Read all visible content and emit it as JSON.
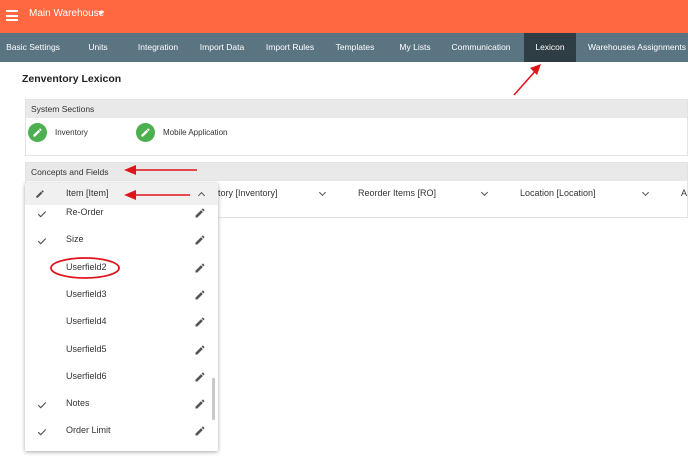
{
  "header": {
    "warehouse_name": "Main Warehouse",
    "menu_icon": "hamburger-icon",
    "caret_icon": "caret-down-icon",
    "accent_color": "#ff6840"
  },
  "nav": {
    "bar_color": "#5b7482",
    "active_color": "#2f3d45",
    "tabs": [
      {
        "label": "Basic Settings"
      },
      {
        "label": "Units"
      },
      {
        "label": "Integration"
      },
      {
        "label": "Import Data"
      },
      {
        "label": "Import Rules"
      },
      {
        "label": "Templates"
      },
      {
        "label": "My Lists"
      },
      {
        "label": "Communication"
      },
      {
        "label": "Lexicon"
      },
      {
        "label": "Warehouses Assignments"
      }
    ],
    "active_tab": "Lexicon"
  },
  "page": {
    "title": "Zenventory Lexicon"
  },
  "system_sections": {
    "heading": "System Sections",
    "items": [
      {
        "label": "Inventory",
        "icon": "pencil-icon"
      },
      {
        "label": "Mobile Application",
        "icon": "pencil-icon"
      }
    ]
  },
  "concepts": {
    "heading": "Concepts and Fields",
    "selects": [
      {
        "label": "Item [Item]"
      },
      {
        "label": "tory [Inventory]"
      },
      {
        "label": "Reorder Items [RO]"
      },
      {
        "label": "Location [Location]"
      },
      {
        "label": "A"
      }
    ]
  },
  "dropdown": {
    "header_label": "Item [Item]",
    "items": [
      {
        "label": "Re-Order",
        "checked": true
      },
      {
        "label": "Size",
        "checked": true
      },
      {
        "label": "Userfield2",
        "checked": false
      },
      {
        "label": "Userfield3",
        "checked": false
      },
      {
        "label": "Userfield4",
        "checked": false
      },
      {
        "label": "Userfield5",
        "checked": false
      },
      {
        "label": "Userfield6",
        "checked": false
      },
      {
        "label": "Notes",
        "checked": true
      },
      {
        "label": "Order Limit",
        "checked": true
      }
    ]
  },
  "annotation_color": "#e0141b"
}
